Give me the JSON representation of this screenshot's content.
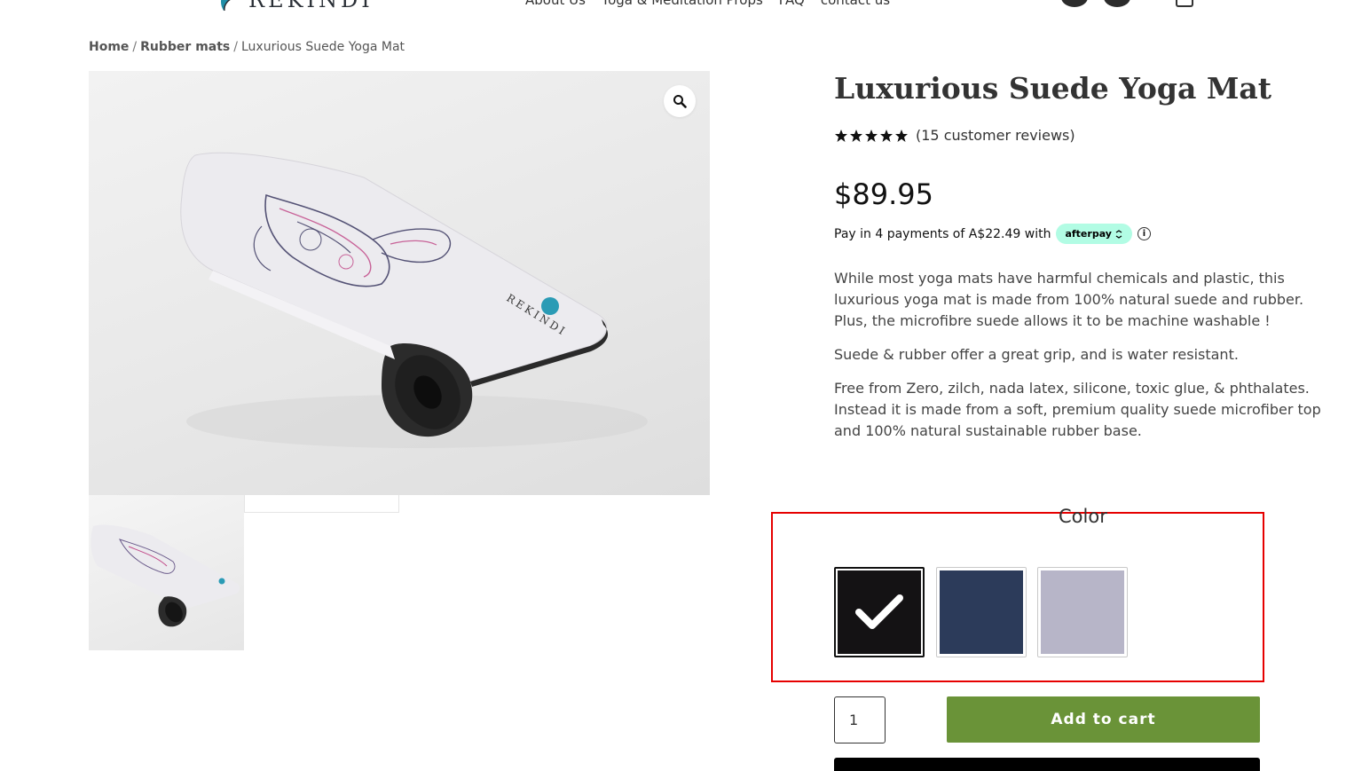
{
  "header": {
    "logo_text": "REKINDI",
    "nav": [
      {
        "label": "About Us"
      },
      {
        "label": "Yoga & Meditation Props"
      },
      {
        "label": "FAQ"
      },
      {
        "label": "contact us"
      }
    ]
  },
  "breadcrumb": {
    "items": [
      "Home",
      "Rubber mats"
    ],
    "separator": "/",
    "current": "Luxurious Suede Yoga Mat"
  },
  "gallery": {
    "mat_brand_text": "REKINDI",
    "zoom_icon": "magnifier-icon"
  },
  "product": {
    "title": "Luxurious Suede Yoga Mat",
    "rating_stars": 5,
    "reviews_text": "(15 customer reviews)",
    "price": "$89.95",
    "afterpay": {
      "text": "Pay in 4 payments of A$22.49 with",
      "badge": "afterpay",
      "info_icon": "info-icon",
      "colors": {
        "badge_bg": "#b2fce4"
      }
    },
    "description": [
      "While most yoga mats have harmful chemicals and plastic, this luxurious yoga mat is made from 100% natural suede and rubber. Plus, the microfibre suede allows it to be machine washable !",
      "Suede & rubber offer a great grip, and is water resistant.",
      "Free from Zero, zilch, nada latex, silicone, toxic glue, & phthalates. Instead it is made from a soft, premium quality suede microfiber top and 100% natural sustainable rubber base."
    ]
  },
  "variation": {
    "label": "Color",
    "swatches": [
      {
        "color": "#141214",
        "selected": true
      },
      {
        "color": "#2c3b5a",
        "selected": false
      },
      {
        "color": "#b7b5c8",
        "selected": false
      }
    ],
    "highlight_color": "#e60000"
  },
  "cart": {
    "quantity": "1",
    "add_to_cart_label": "Add to cart",
    "button_color": "#6a9338"
  }
}
